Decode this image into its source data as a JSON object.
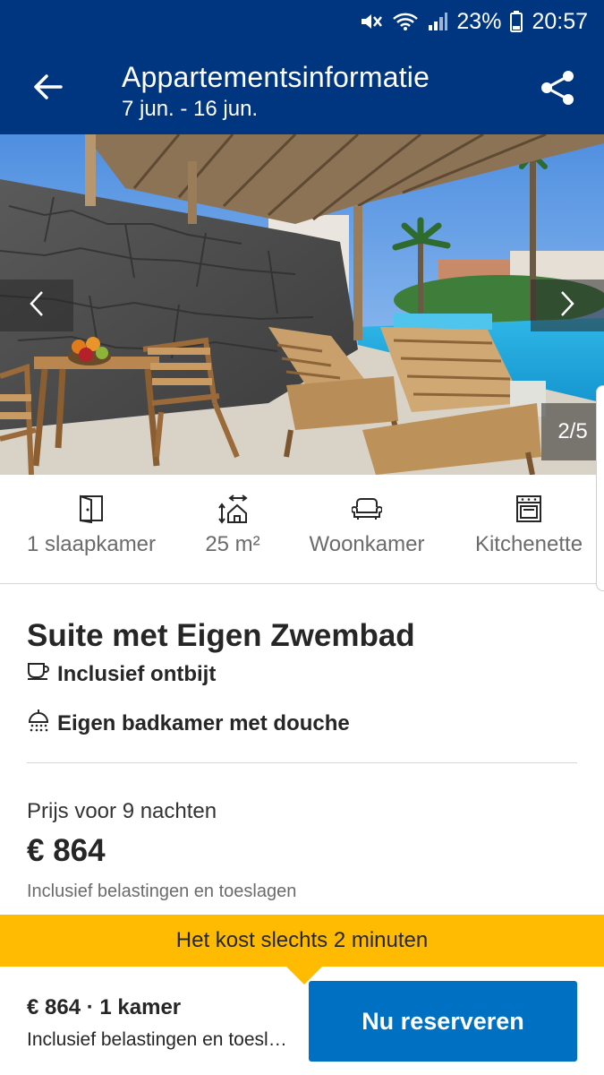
{
  "status_bar": {
    "battery": "23%",
    "time": "20:57",
    "icons": [
      "mute-icon",
      "wifi-icon",
      "signal-icon",
      "battery-icon"
    ]
  },
  "header": {
    "title": "Appartementsinformatie",
    "dates": "7 jun. - 16 jun.",
    "back_icon": "arrow-left-icon",
    "share_icon": "share-icon",
    "background": "#003580"
  },
  "gallery": {
    "counter": "2/5",
    "prev_icon": "chevron-left-icon",
    "next_icon": "chevron-right-icon"
  },
  "facilities": [
    {
      "icon": "door-icon",
      "label": "1 slaapkamer"
    },
    {
      "icon": "room-size-icon",
      "label": "25 m²"
    },
    {
      "icon": "sofa-icon",
      "label": "Woonkamer"
    },
    {
      "icon": "oven-icon",
      "label": "Kitchenette"
    }
  ],
  "room": {
    "title": "Suite met Eigen Zwembad",
    "features": [
      {
        "icon": "coffee-cup-icon",
        "label": "Inclusief ontbijt"
      },
      {
        "icon": "shower-icon",
        "label": "Eigen badkamer met douche"
      }
    ]
  },
  "price": {
    "caption": "Prijs voor 9 nachten",
    "value": "€ 864",
    "note": "Inclusief belastingen en toeslagen"
  },
  "banner": {
    "text": "Het kost slechts 2 minuten",
    "color": "#febb02"
  },
  "bottom_bar": {
    "summary": "€ 864 · 1 kamer",
    "note": "Inclusief belastingen en toeslagen",
    "button_label": "Nu reserveren",
    "button_color": "#0071c2"
  }
}
